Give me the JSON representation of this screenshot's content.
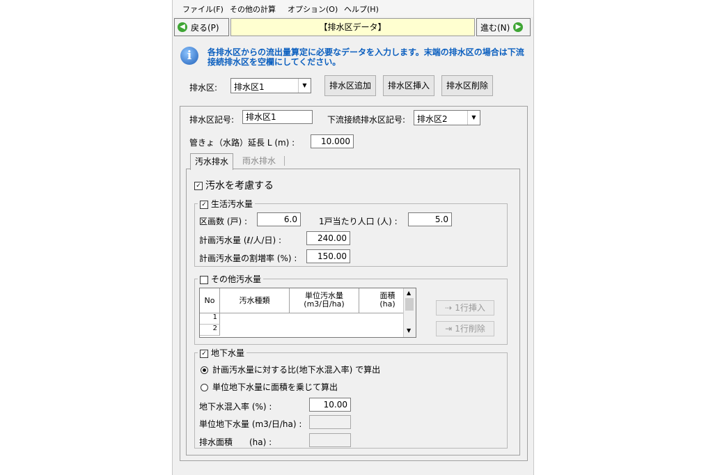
{
  "menu": [
    "ファイル(F)",
    "その他の計算",
    "オプション(O)",
    "ヘルプ(H)"
  ],
  "nav": {
    "back": "戻る(P)",
    "title": "【排水区データ】",
    "next": "進む(N)"
  },
  "info": "各排水区からの流出量算定に必要なデータを入力します。末端の排水区の場合は下流接続排水区を空欄にしてください。",
  "district_row": {
    "label": "排水区:",
    "value": "排水区1",
    "add": "排水区追加",
    "insert": "排水区挿入",
    "delete": "排水区削除"
  },
  "detail": {
    "code_label": "排水区記号:",
    "code_value": "排水区1",
    "down_label": "下流接続排水区記号:",
    "down_value": "排水区2",
    "length_label": "管きょ（水路）延長 L (m) :",
    "length_value": "10.000"
  },
  "tabs": [
    "汚水排水",
    "雨水排水"
  ],
  "sewage": {
    "consider_label": "汚水を考慮する",
    "living": {
      "title": "生活汚水量",
      "parcels_label": "区画数 (戸) :",
      "parcels_value": "6.0",
      "per_house_label": "1戸当たり人口 (人) :",
      "per_house_value": "5.0",
      "plan_label": "計画汚水量 (ℓ/人/日) :",
      "plan_value": "240.00",
      "increase_label": "計画汚水量の割増率 (%) :",
      "increase_value": "150.00"
    },
    "other": {
      "title": "その他汚水量",
      "headers": [
        "No",
        "汚水種類",
        "単位汚水量\n(m3/日/ha)",
        "面積\n(ha)"
      ],
      "rows": [
        "1",
        "2"
      ],
      "insert_btn": "1行挿入",
      "delete_btn": "1行削除"
    },
    "ground": {
      "title": "地下水量",
      "opt1": "計画汚水量に対する比(地下水混入率) で算出",
      "opt2": "単位地下水量に面積を乗じて算出",
      "rate_label": "地下水混入率 (%) :",
      "rate_value": "10.00",
      "unit_label": "単位地下水量 (m3/日/ha) :",
      "area_label": "排水面積　　(ha) :"
    }
  }
}
